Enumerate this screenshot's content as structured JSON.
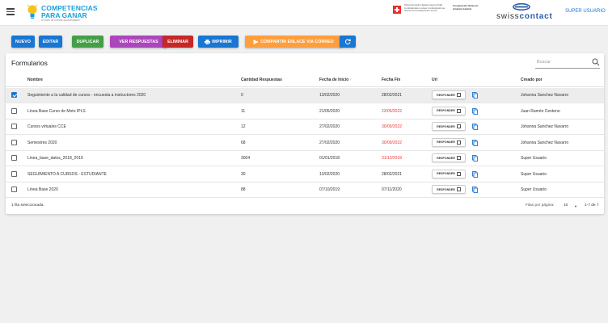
{
  "header": {
    "logo_line1": "COMPETENCIAS",
    "logo_line2": "PARA GANAR",
    "logo_tagline": "El inicio de nuevas oportunidades",
    "swiss_gov_text": "Schweizerische Eidgenossenschaft Confédération suisse Confederazione Svizzera Confederaziun svizra",
    "swiss_agency_text": "Cooperación Suiza en América Central",
    "swisscontact_prefix": "swiss",
    "swisscontact_suffix": "contact",
    "user": "SUPER USUARIO"
  },
  "toolbar": {
    "buttons": [
      {
        "label": "NUEVO",
        "color": "#1976d2"
      },
      {
        "label": "EDITAR",
        "color": "#1976d2"
      },
      {
        "label": "DUPLICAR",
        "color": "#43a047"
      },
      {
        "label": "VER RESPUESTAS",
        "color": "#ab47bc"
      },
      {
        "label": "ELIMINAR",
        "color": "#c62828"
      },
      {
        "label": "IMPRIMIR",
        "color": "#1976d2"
      },
      {
        "label": "COMPARTIR ENLACE VIA CORREO",
        "color": "#ff9e3d"
      },
      {
        "label": "",
        "color": "#1976d2"
      }
    ]
  },
  "card": {
    "title": "Formularios",
    "search_placeholder": "Buscar"
  },
  "table": {
    "headers": {
      "nombre": "Nombre",
      "cantidad": "Cantidad Respuestas",
      "inicio": "Fecha de Inicio",
      "sort_arrow": "↑",
      "fin": "Fecha Fin",
      "url": "Url",
      "creado": "Creado por"
    },
    "response_button": "RESPONDER",
    "rows": [
      {
        "nombre": "Seguimiento a la calidad de cursos - encuesta a instructores 2020",
        "cantidad": "0",
        "inicio": "13/02/2020",
        "fin": "28/02/2021",
        "fin_expired": false,
        "creado": "Johanna Sanchez Navarro",
        "selected": true
      },
      {
        "nombre": "Línea Base Curso de Moto IPLS",
        "cantidad": "11",
        "inicio": "21/05/2020",
        "fin": "23/05/2022",
        "fin_expired": true,
        "creado": "Juan Ramón Centeno",
        "selected": false
      },
      {
        "nombre": "Cursos virtuales CCE",
        "cantidad": "12",
        "inicio": "27/02/2020",
        "fin": "30/09/2022",
        "fin_expired": true,
        "creado": "Johanna Sanchez Navarro",
        "selected": false
      },
      {
        "nombre": "Semestres 2020",
        "cantidad": "68",
        "inicio": "27/02/2020",
        "fin": "30/09/2022",
        "fin_expired": true,
        "creado": "Johanna Sanchez Navarro",
        "selected": false
      },
      {
        "nombre": "Linea_base_datos_2018_2019",
        "cantidad": "3004",
        "inicio": "01/01/2018",
        "fin": "31/12/2019",
        "fin_expired": true,
        "creado": "Super Usuario",
        "selected": false
      },
      {
        "nombre": "SEGUIMIENTO A CURSOS - ESTUDIANTE",
        "cantidad": "30",
        "inicio": "13/02/2020",
        "fin": "28/02/2021",
        "fin_expired": false,
        "creado": "Super Usuario",
        "selected": false
      },
      {
        "nombre": "Línea Base 2020",
        "cantidad": "88",
        "inicio": "07/10/2019",
        "fin": "07/11/2020",
        "fin_expired": false,
        "creado": "Super Usuario",
        "selected": false
      }
    ]
  },
  "footer": {
    "selected_text": "1 fila seleccionada.",
    "rows_per_page_label": "Filas por página:",
    "rows_per_page_value": "10",
    "range": "1-7 de 7"
  },
  "colors": {
    "primary": "#1976d2",
    "expired": "#e53935"
  }
}
